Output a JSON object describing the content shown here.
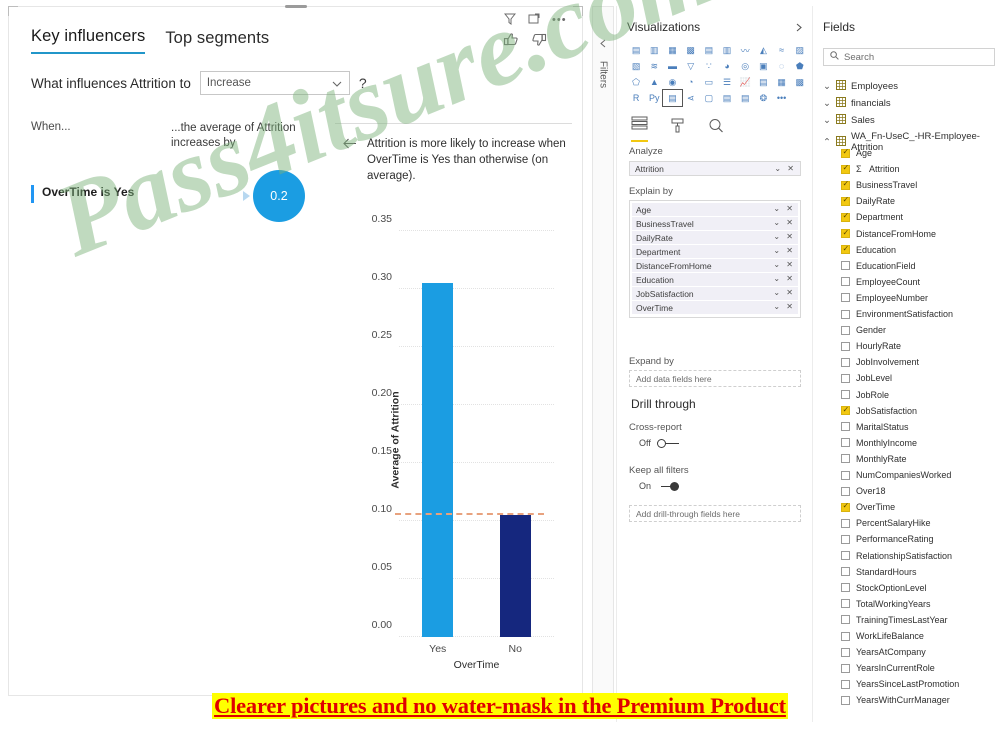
{
  "visual": {
    "tabs": [
      {
        "label": "Key influencers",
        "active": true
      },
      {
        "label": "Top segments",
        "active": false
      }
    ],
    "header_icons": [
      "filter-icon",
      "focus-mode-icon",
      "more-options-icon",
      "thumbs-up-icon",
      "thumbs-down-icon"
    ],
    "question_prefix": "What influences Attrition to",
    "question_value": "Increase",
    "question_suffix": "?",
    "col_when": "When...",
    "col_average": "...the average of Attrition increases by",
    "influencer": {
      "label": "OverTime is Yes",
      "value": "0.2"
    },
    "detail_text": "Attrition is more likely to increase when OverTime is Yes than otherwise (on average)."
  },
  "chart_data": {
    "type": "bar",
    "title": "",
    "xlabel": "OverTime",
    "ylabel": "Average of Attrition",
    "categories": [
      "Yes",
      "No"
    ],
    "values": [
      0.305,
      0.105
    ],
    "colors": [
      "#1b9de2",
      "#15277e"
    ],
    "ylim": [
      0.0,
      0.375
    ],
    "yticks": [
      0.0,
      0.05,
      0.1,
      0.15,
      0.2,
      0.25,
      0.3,
      0.35
    ],
    "ytick_labels": [
      "0.00",
      "0.05",
      "0.10",
      "0.15",
      "0.20",
      "0.25",
      "0.30",
      "0.35"
    ],
    "grid": true,
    "legend": "none",
    "average_line": {
      "value": 0.105,
      "color": "#e8a27e",
      "style": "dashed"
    }
  },
  "filters_rail": {
    "label": "Filters",
    "collapse_icon": "chevron-left-icon"
  },
  "visualizations": {
    "title": "Visualizations",
    "collapse_icon": "chevron-right-icon",
    "icon_rows": [
      [
        "stacked-bar-chart-icon",
        "stacked-column-chart-icon",
        "clustered-bar-chart-icon",
        "clustered-column-chart-icon",
        "hundred-stacked-bar-icon",
        "hundred-stacked-column-icon",
        "line-chart-icon",
        "area-chart-icon",
        "stacked-area-chart-icon",
        "line-stacked-column-icon"
      ],
      [
        "line-clustered-column-icon",
        "ribbon-chart-icon",
        "waterfall-chart-icon",
        "funnel-chart-icon",
        "scatter-chart-icon",
        "pie-chart-icon",
        "donut-chart-icon",
        "treemap-icon",
        "map-icon",
        "filled-map-icon"
      ],
      [
        "shape-map-icon",
        "azure-map-icon",
        "arcgis-map-icon",
        "gauge-icon",
        "card-icon",
        "multi-row-card-icon",
        "kpi-icon",
        "slicer-icon",
        "table-icon",
        "matrix-icon",
        "r-visual-icon"
      ],
      [
        "python-visual-icon",
        "key-influencers-icon",
        "decomposition-tree-icon",
        "qa-visual-icon",
        "smart-narrative-icon",
        "paginated-report-icon",
        "metrics-icon",
        "more-visuals-icon"
      ]
    ],
    "selected_visual": "key-influencers-icon",
    "pane_tabs": [
      {
        "name": "fields-tab",
        "icon": "fields-icon",
        "selected": true
      },
      {
        "name": "format-tab",
        "icon": "paint-roller-icon",
        "selected": false
      },
      {
        "name": "analytics-tab",
        "icon": "analytics-magnifier-icon",
        "selected": false
      }
    ],
    "analyze_label": "Analyze",
    "analyze_field": "Attrition",
    "explain_label": "Explain by",
    "explain_fields": [
      "Age",
      "BusinessTravel",
      "DailyRate",
      "Department",
      "DistanceFromHome",
      "Education",
      "JobSatisfaction",
      "OverTime"
    ],
    "expand_label": "Expand by",
    "expand_placeholder": "Add data fields here",
    "drill_title": "Drill through",
    "cross_report_label": "Cross-report",
    "cross_report_state": "Off",
    "keep_filters_label": "Keep all filters",
    "keep_filters_state": "On",
    "drill_placeholder": "Add drill-through fields here"
  },
  "fields": {
    "title": "Fields",
    "search_placeholder": "Search",
    "search_icon": "search-icon",
    "tables": [
      {
        "name": "Employees",
        "expanded": false
      },
      {
        "name": "financials",
        "expanded": false
      },
      {
        "name": "Sales",
        "expanded": false
      },
      {
        "name": "WA_Fn-UseC_-HR-Employee-Attrition",
        "expanded": true
      }
    ],
    "columns": [
      {
        "name": "Age",
        "checked": true,
        "measure": false
      },
      {
        "name": "Attrition",
        "checked": true,
        "measure": true
      },
      {
        "name": "BusinessTravel",
        "checked": true,
        "measure": false
      },
      {
        "name": "DailyRate",
        "checked": true,
        "measure": false
      },
      {
        "name": "Department",
        "checked": true,
        "measure": false
      },
      {
        "name": "DistanceFromHome",
        "checked": true,
        "measure": false
      },
      {
        "name": "Education",
        "checked": true,
        "measure": false
      },
      {
        "name": "EducationField",
        "checked": false,
        "measure": false
      },
      {
        "name": "EmployeeCount",
        "checked": false,
        "measure": false
      },
      {
        "name": "EmployeeNumber",
        "checked": false,
        "measure": false
      },
      {
        "name": "EnvironmentSatisfaction",
        "checked": false,
        "measure": false
      },
      {
        "name": "Gender",
        "checked": false,
        "measure": false
      },
      {
        "name": "HourlyRate",
        "checked": false,
        "measure": false
      },
      {
        "name": "JobInvolvement",
        "checked": false,
        "measure": false
      },
      {
        "name": "JobLevel",
        "checked": false,
        "measure": false
      },
      {
        "name": "JobRole",
        "checked": false,
        "measure": false
      },
      {
        "name": "JobSatisfaction",
        "checked": true,
        "measure": false
      },
      {
        "name": "MaritalStatus",
        "checked": false,
        "measure": false
      },
      {
        "name": "MonthlyIncome",
        "checked": false,
        "measure": false
      },
      {
        "name": "MonthlyRate",
        "checked": false,
        "measure": false
      },
      {
        "name": "NumCompaniesWorked",
        "checked": false,
        "measure": false
      },
      {
        "name": "Over18",
        "checked": false,
        "measure": false
      },
      {
        "name": "OverTime",
        "checked": true,
        "measure": false
      },
      {
        "name": "PercentSalaryHike",
        "checked": false,
        "measure": false
      },
      {
        "name": "PerformanceRating",
        "checked": false,
        "measure": false
      },
      {
        "name": "RelationshipSatisfaction",
        "checked": false,
        "measure": false
      },
      {
        "name": "StandardHours",
        "checked": false,
        "measure": false
      },
      {
        "name": "StockOptionLevel",
        "checked": false,
        "measure": false
      },
      {
        "name": "TotalWorkingYears",
        "checked": false,
        "measure": false
      },
      {
        "name": "TrainingTimesLastYear",
        "checked": false,
        "measure": false
      },
      {
        "name": "WorkLifeBalance",
        "checked": false,
        "measure": false
      },
      {
        "name": "YearsAtCompany",
        "checked": false,
        "measure": false
      },
      {
        "name": "YearsInCurrentRole",
        "checked": false,
        "measure": false
      },
      {
        "name": "YearsSinceLastPromotion",
        "checked": false,
        "measure": false
      },
      {
        "name": "YearsWithCurrManager",
        "checked": false,
        "measure": false
      }
    ]
  },
  "watermarks": {
    "diagonal": "Pass4itsure.com",
    "banner": "Clearer pictures and no water-mask in the Premium Product"
  }
}
